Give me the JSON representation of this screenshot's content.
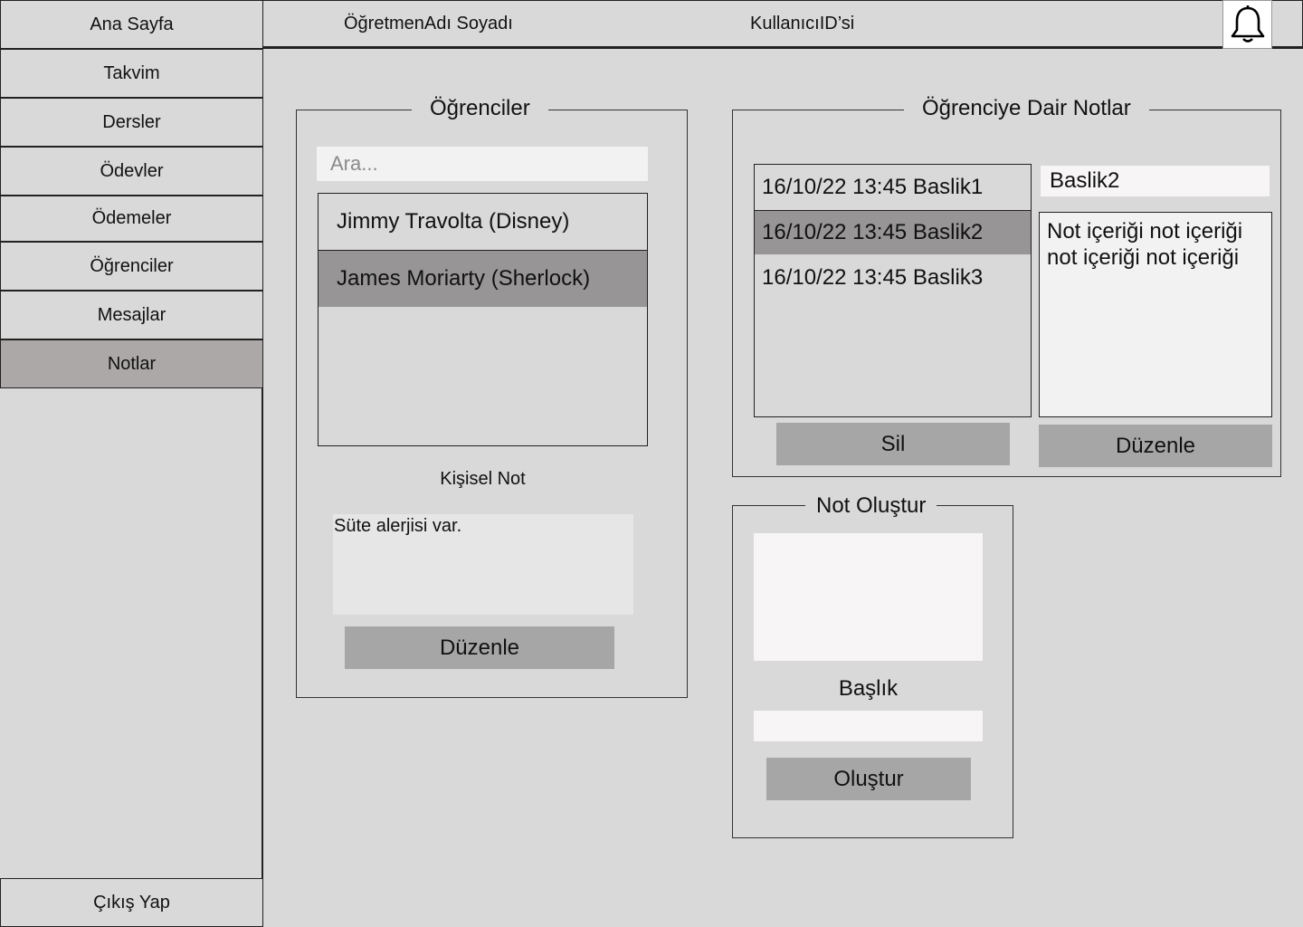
{
  "sidebar": {
    "home": "Ana Sayfa",
    "items": [
      {
        "label": "Takvim"
      },
      {
        "label": "Dersler"
      },
      {
        "label": "Ödevler"
      },
      {
        "label": "Ödemeler"
      },
      {
        "label": "Öğrenciler"
      },
      {
        "label": "Mesajlar"
      },
      {
        "label": "Notlar",
        "active": true
      }
    ],
    "logout": "Çıkış Yap"
  },
  "header": {
    "teacher_name": "ÖğretmenAdı Soyadı",
    "user_id": "KullanıcıID’si",
    "bell_icon": "bell-icon"
  },
  "students_panel": {
    "title": "Öğrenciler",
    "search_placeholder": "Ara...",
    "students": [
      {
        "name": "Jimmy Travolta (Disney)"
      },
      {
        "name": "James Moriarty (Sherlock)",
        "selected": true
      }
    ],
    "personal_note_label": "Kişisel Not",
    "personal_note_text": "Süte alerjisi var.",
    "edit_button": "Düzenle"
  },
  "notes_panel": {
    "title": "Öğrenciye Dair Notlar",
    "notes": [
      {
        "label": "16/10/22 13:45 Baslik1"
      },
      {
        "label": "16/10/22 13:45 Baslik2",
        "selected": true
      },
      {
        "label": "16/10/22 13:45 Baslik3"
      }
    ],
    "selected_title": "Baslik2",
    "selected_content": "Not içeriği not içeriği not içeriği not içeriği",
    "delete_button": "Sil",
    "edit_button": "Düzenle"
  },
  "create_panel": {
    "title": "Not Oluştur",
    "title_label": "Başlık",
    "create_button": "Oluştur"
  },
  "colors": {
    "background": "#d9d9d9",
    "selected": "#979595",
    "active_sidebar": "#aca8a8",
    "button": "#a6a6a6"
  }
}
